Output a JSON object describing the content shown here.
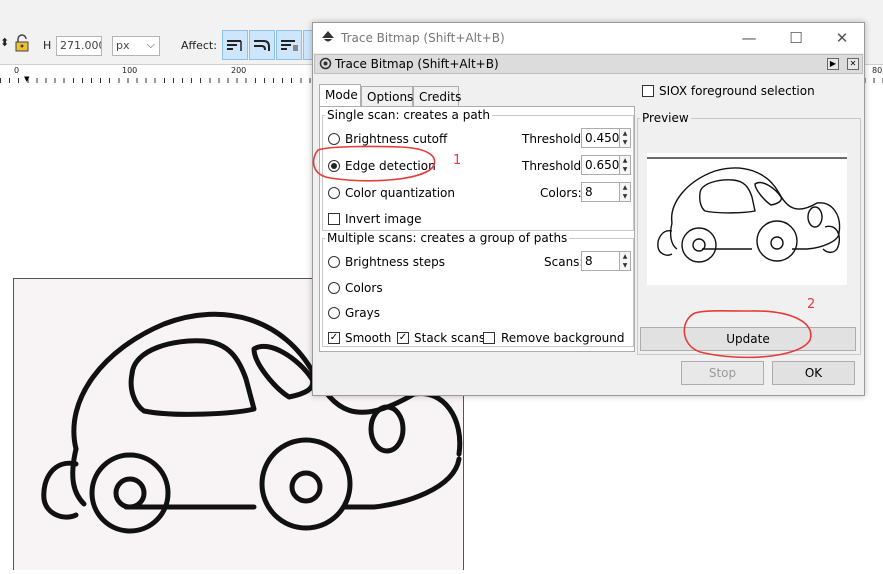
{
  "toolbar": {
    "h_label": "H",
    "h_value": "271.000",
    "unit": "px",
    "affect_label": "Affect:"
  },
  "ruler": {
    "labels": [
      "0",
      "100",
      "200",
      "80"
    ]
  },
  "dialog": {
    "window_title": "Trace Bitmap (Shift+Alt+B)",
    "panel_title": "Trace Bitmap (Shift+Alt+B)",
    "tabs": [
      "Mode",
      "Options",
      "Credits"
    ],
    "single_scan": {
      "title": "Single scan: creates a path",
      "options": [
        {
          "label": "Brightness cutoff",
          "param_label": "Threshold:",
          "param_value": "0.450",
          "selected": false
        },
        {
          "label": "Edge detection",
          "param_label": "Threshold:",
          "param_value": "0.650",
          "selected": true
        },
        {
          "label": "Color quantization",
          "param_label": "Colors:",
          "param_value": "8",
          "selected": false
        }
      ],
      "invert_label": "Invert image",
      "invert_checked": false
    },
    "multiple_scans": {
      "title": "Multiple scans: creates a group of paths",
      "options": [
        {
          "label": "Brightness steps",
          "selected": false
        },
        {
          "label": "Colors",
          "selected": false
        },
        {
          "label": "Grays",
          "selected": false
        }
      ],
      "scans_label": "Scans:",
      "scans_value": "8",
      "smooth_label": "Smooth",
      "smooth_checked": true,
      "stack_label": "Stack scans",
      "stack_checked": true,
      "remove_bg_label": "Remove background",
      "remove_bg_checked": false
    },
    "siox_label": "SIOX foreground selection",
    "siox_checked": false,
    "preview_title": "Preview",
    "update_label": "Update",
    "stop_label": "Stop",
    "ok_label": "OK"
  },
  "annotations": {
    "mark1": "1",
    "mark2": "2"
  },
  "colors": {
    "annotation": "#e53b3b",
    "affect_active": "#cde6fb"
  },
  "icons": [
    "lock-icon",
    "inkscape-icon",
    "minimize-icon",
    "maximize-icon",
    "close-icon",
    "trace-bitmap-icon"
  ]
}
